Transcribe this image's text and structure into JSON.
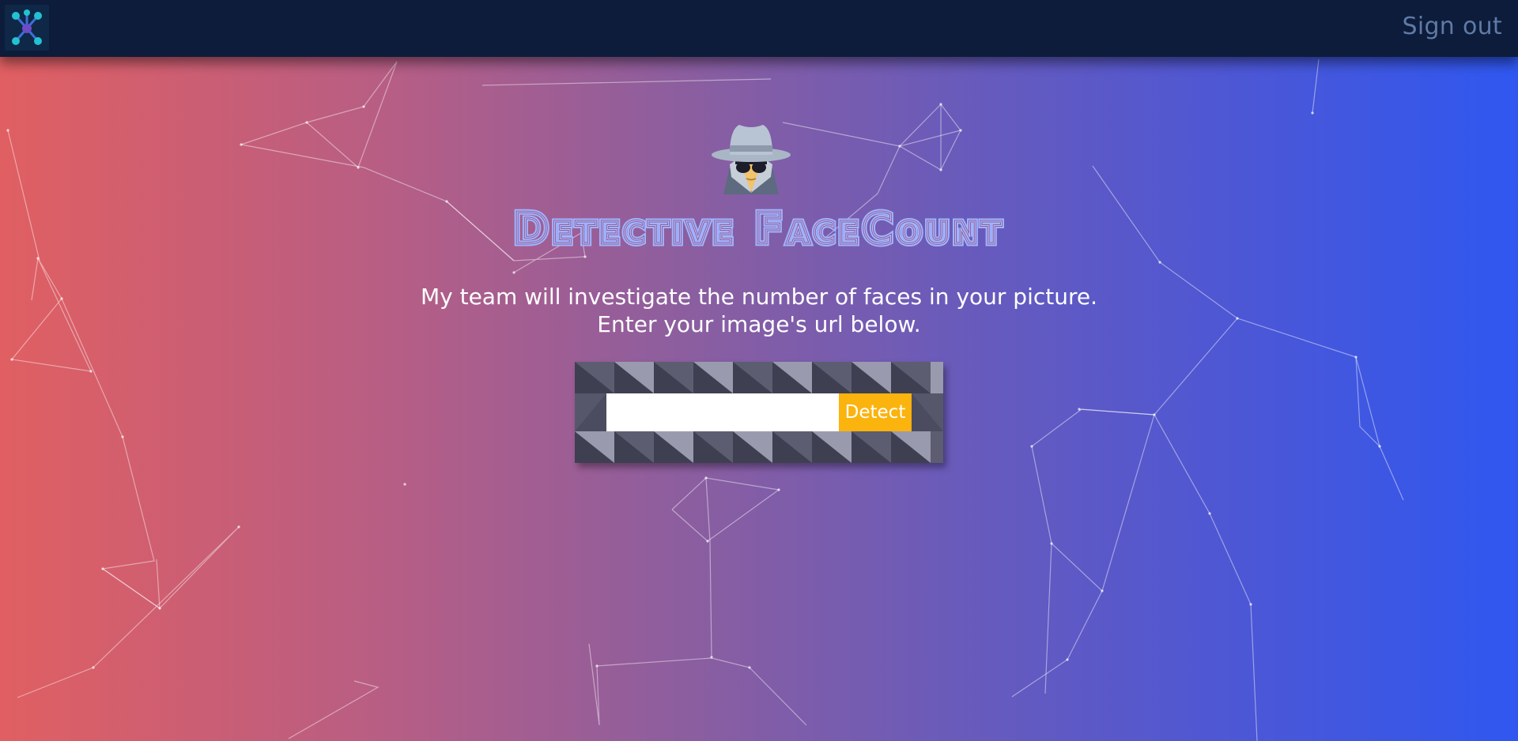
{
  "header": {
    "logo_icon": "molecule-network-icon",
    "signout_label": "Sign out"
  },
  "hero": {
    "detective_icon": "detective-spy-icon",
    "title": "Detective FaceCount",
    "subtitle_line1": "My team will investigate the number of faces in your picture.",
    "subtitle_line2": "Enter your image's url below."
  },
  "form": {
    "input_value": "",
    "input_placeholder": "",
    "detect_label": "Detect"
  },
  "colors": {
    "topbar": "#0c1c3a",
    "signout_text": "#5f7aa6",
    "detect_button": "#fbb30e",
    "title_outline": "#9fb4ff",
    "gradient_left": "#e05f62",
    "gradient_right": "#2f57f0"
  }
}
